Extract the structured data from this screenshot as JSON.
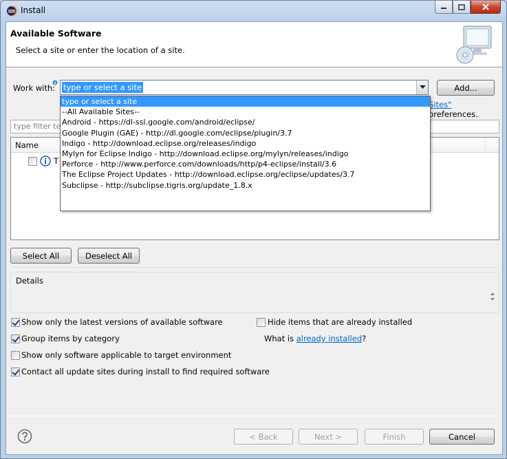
{
  "window": {
    "title": "Install"
  },
  "banner": {
    "title": "Available Software",
    "message": "Select a site or enter the location of a site."
  },
  "work_with": {
    "label": "Work with:",
    "value": "type or select a site",
    "add_button": "Add...",
    "manage_link_suffix": "Sites\"",
    "preferences_text": " preferences."
  },
  "dropdown": {
    "options": [
      "type or select a site",
      "--All Available Sites--",
      "Android - https://dl-ssl.google.com/android/eclipse/",
      "Google Plugin (GAE) - http://dl.google.com/eclipse/plugin/3.7",
      "Indigo - http://download.eclipse.org/releases/indigo",
      "Mylyn for Eclipse Indigo - http://download.eclipse.org/mylyn/releases/indigo",
      "Perforce - http://www.perforce.com/downloads/http/p4-eclipse/install/3.6",
      "The Eclipse Project Updates - http://download.eclipse.org/eclipse/updates/3.7",
      "Subclipse - http://subclipse.tigris.org/update_1.8.x"
    ]
  },
  "filter": {
    "placeholder": "type filter tex"
  },
  "tree": {
    "column_name": "Name",
    "row_text": "T"
  },
  "buttons": {
    "select_all": "Select All",
    "deselect_all": "Deselect All",
    "back": "< Back",
    "next": "Next >",
    "finish": "Finish",
    "cancel": "Cancel"
  },
  "details": {
    "label": "Details"
  },
  "options": {
    "latest_versions": {
      "label": "Show only the latest versions of available software",
      "checked": true
    },
    "hide_installed": {
      "label": "Hide items that are already installed",
      "checked": false
    },
    "group_by_category": {
      "label": "Group items by category",
      "checked": true
    },
    "target_env": {
      "label": "Show only software applicable to target environment",
      "checked": false
    },
    "contact_sites": {
      "label": "Contact all update sites during install to find required software",
      "checked": true
    },
    "what_is_prefix": "What is ",
    "already_installed_link": "already installed",
    "what_is_suffix": "?"
  }
}
